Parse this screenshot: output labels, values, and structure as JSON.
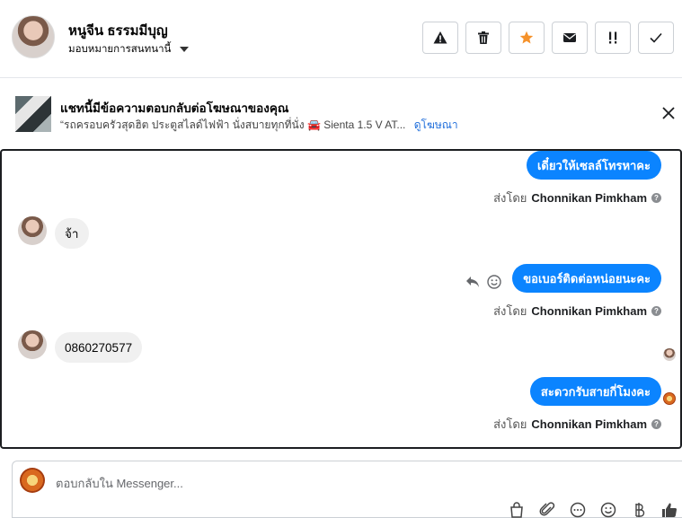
{
  "header": {
    "contact_name": "หนูจีน ธรรมมีบุญ",
    "assign_label": "มอบหมายการสนทนานี้",
    "actions": [
      {
        "name": "warning",
        "icon": "warning-icon"
      },
      {
        "name": "delete",
        "icon": "trash-icon"
      },
      {
        "name": "star",
        "icon": "star-icon"
      },
      {
        "name": "mail",
        "icon": "envelope-icon"
      },
      {
        "name": "priority",
        "icon": "double-exclamation-icon"
      },
      {
        "name": "done",
        "icon": "checkmark-icon"
      }
    ]
  },
  "ad": {
    "title": "แชทนี้มีข้อความตอบกลับต่อโฆษณาของคุณ",
    "subtitle": "“รถครอบครัวสุดฮิต ประตูสไลด์ไฟฟ้า นั่งสบายทุกที่นั่ง 🚘 Sienta 1.5 V AT...",
    "link": "ดูโฆษณา"
  },
  "messages": [
    {
      "dir": "out",
      "text": "เดี๋ยวให้เซลล์โทรหาคะ",
      "sent_by_prefix": "ส่งโดย",
      "sent_by": "Chonnikan Pimkham"
    },
    {
      "dir": "in",
      "text": "จ้า"
    },
    {
      "dir": "out",
      "text": "ขอเบอร์ติดต่อหน่อยนะคะ",
      "sent_by_prefix": "ส่งโดย",
      "sent_by": "Chonnikan Pimkham"
    },
    {
      "dir": "in",
      "text": "0860270577"
    },
    {
      "dir": "out",
      "text": "สะดวกรับสายกี่โมงคะ",
      "sent_by_prefix": "ส่งโดย",
      "sent_by": "Chonnikan Pimkham"
    }
  ],
  "composer": {
    "placeholder": "ตอบกลับใน Messenger..."
  },
  "colors": {
    "accent": "#0b84ff",
    "star": "#f5922b",
    "link": "#216fdb"
  }
}
